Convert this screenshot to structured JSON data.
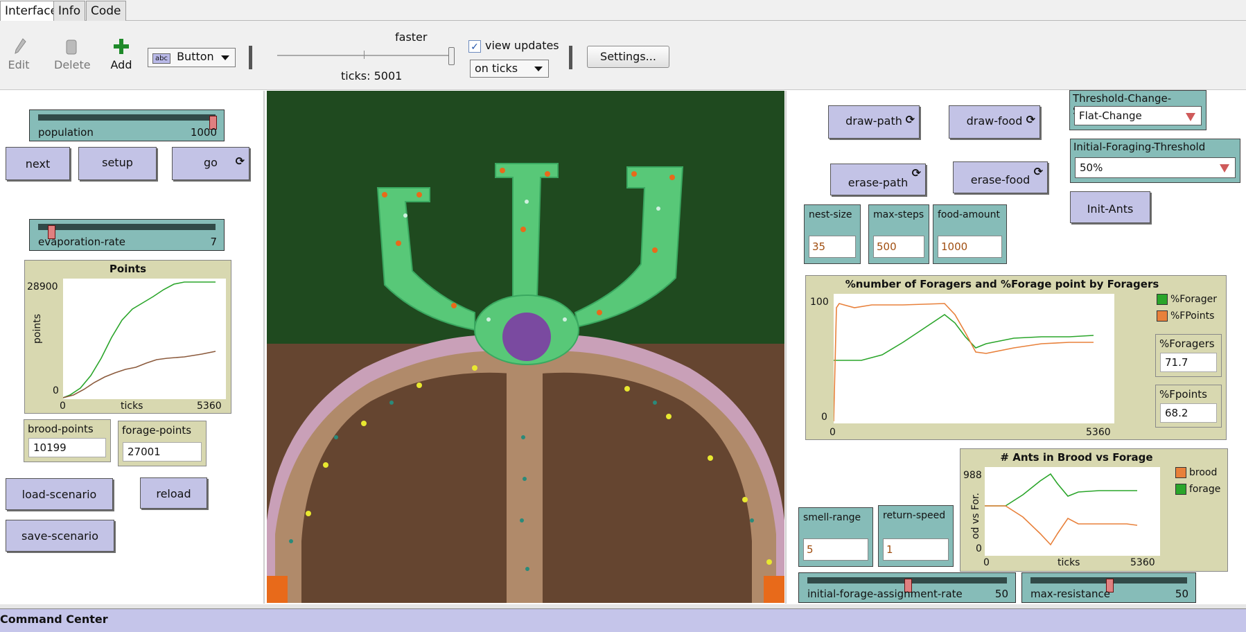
{
  "tabs": [
    "Interface",
    "Info",
    "Code"
  ],
  "toolbar": {
    "edit_label": "Edit",
    "delete_label": "Delete",
    "add_label": "Add",
    "widget_type": "Button",
    "widget_type_icon": "abc",
    "speed_label": "faster",
    "ticks_label": "ticks: 5001",
    "view_updates_label": "view updates",
    "view_updates_checked": true,
    "update_mode": "on ticks",
    "settings_label": "Settings..."
  },
  "left": {
    "population": {
      "label": "population",
      "value": "1000",
      "fraction": 0.98
    },
    "buttons": {
      "next": "next",
      "setup": "setup",
      "go": "go"
    },
    "evaporation": {
      "label": "evaporation-rate",
      "value": "7",
      "fraction": 0.07
    },
    "points_plot": {
      "title": "Points",
      "ymax": "28900",
      "ymin": "0",
      "xmin": "0",
      "xmax": "5360",
      "xlabel": "ticks",
      "ylabel": "points"
    },
    "brood_points": {
      "label": "brood-points",
      "value": "10199"
    },
    "forage_points": {
      "label": "forage-points",
      "value": "27001"
    },
    "load_scenario": "load-scenario",
    "reload": "reload",
    "save_scenario": "save-scenario"
  },
  "right": {
    "draw_path": "draw-path",
    "draw_food": "draw-food",
    "erase_path": "erase-path",
    "erase_food": "erase-food",
    "threshold_scheme": {
      "label": "Threshold-Change-Scheme",
      "value": "Flat-Change"
    },
    "initial_threshold": {
      "label": "Initial-Foraging-Threshold",
      "value": "50%"
    },
    "init_ants": "Init-Ants",
    "nest_size": {
      "label": "nest-size",
      "value": "35"
    },
    "max_steps": {
      "label": "max-steps",
      "value": "500"
    },
    "food_amount": {
      "label": "food-amount",
      "value": "1000"
    },
    "foragers_plot": {
      "title": "%number of Foragers and %Forage point by Foragers",
      "ymax": "100",
      "ymin": "0",
      "xmin": "0",
      "xmax": "5360",
      "legend": [
        "%Forager",
        "%FPoints"
      ]
    },
    "pct_foragers": {
      "label": "%Foragers",
      "value": "71.7"
    },
    "pct_fpoints": {
      "label": "%Fpoints",
      "value": "68.2"
    },
    "ants_plot": {
      "title": "# Ants in Brood vs Forage",
      "ymax": "988",
      "ymin": "0",
      "xmin": "0",
      "xmax": "5360",
      "xlabel": "ticks",
      "ylabel": "od vs For.",
      "legend": [
        "brood",
        "forage"
      ]
    },
    "smell_range": {
      "label": "smell-range",
      "value": "5"
    },
    "return_speed": {
      "label": "return-speed",
      "value": "1"
    },
    "forage_rate": {
      "label": "initial-forage-assignment-rate",
      "value": "50",
      "fraction": 0.5
    },
    "max_resistance": {
      "label": "max-resistance",
      "value": "50",
      "fraction": 0.5
    }
  },
  "command_center": {
    "title": "Command Center"
  },
  "colors": {
    "button": "#c3c3e6",
    "slider": "#86bcb8",
    "monitor": "#d8d8b0",
    "green_series": "#2aa52a",
    "orange_series": "#e8803a",
    "brown_series": "#8b5a3c"
  }
}
